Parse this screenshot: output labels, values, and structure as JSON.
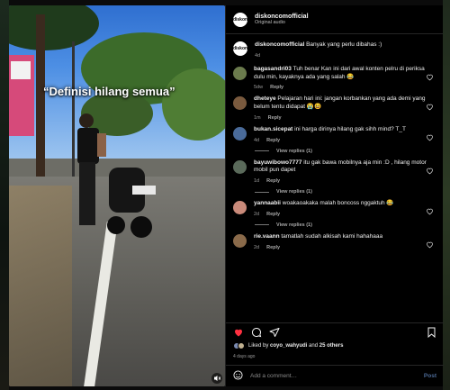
{
  "post": {
    "username": "diskoncomofficial",
    "audio": "Original audio",
    "avatar_text": "diskon",
    "video_overlay_text": "“Definisi hilang semua”",
    "caption_text": "Banyak yang perlu dibahas :)",
    "caption_time": "4d"
  },
  "comments": [
    {
      "user": "bagasandri03",
      "text": "Tuh benar Kan ini dari awal konten pelru di periksa dulu min, kayaknya ada yang salah 😂",
      "time": "5dw",
      "reply": "Reply",
      "avatar_color": "#6b7b4d"
    },
    {
      "user": "dheteye",
      "text": "Pelajaran hari ini: jangan korbankan yang ada demi yang belum tentu didapat 😭😆",
      "time": "1m",
      "reply": "Reply",
      "avatar_color": "#7a5a3e"
    },
    {
      "user": "bukan.sicepat",
      "text": "ini harga dirinya hilang gak sihh mind? T_T",
      "time": "4d",
      "reply": "Reply",
      "avatar_color": "#4a6b9a"
    },
    {
      "user": "bayuwibowo7777",
      "text": "itu gak bawa mobilnya aja min :D , hilang motor mobil pun dapet",
      "time": "1d",
      "reply": "Reply",
      "avatar_color": "#5a6a5a"
    },
    {
      "user": "yannaabii",
      "text": "woakaoakaka malah boncoss nggaktuh 😂",
      "time": "2d",
      "reply": "Reply",
      "avatar_color": "#c98a7a"
    },
    {
      "user": "rie.vaann",
      "text": "tamatlah sudah alkisah kami hahahaaa",
      "time": "2d",
      "reply": "Reply",
      "avatar_color": "#8a6a4a"
    }
  ],
  "view_replies": [
    "View replies (1)",
    "View replies (1)",
    "View replies (1)"
  ],
  "likes": {
    "prefix": "Liked by",
    "user": "coyo_wahyudi",
    "and": "and",
    "others": "25 others"
  },
  "posted_ago": "4 days ago",
  "add_comment_placeholder": "Add a comment…",
  "post_button": "Post",
  "icons": [
    "heart-icon",
    "comment-icon",
    "share-icon",
    "bookmark-icon",
    "smile-icon",
    "mute-icon"
  ],
  "colors": {
    "like": "#ff3040",
    "accent": "#4c6a96"
  }
}
